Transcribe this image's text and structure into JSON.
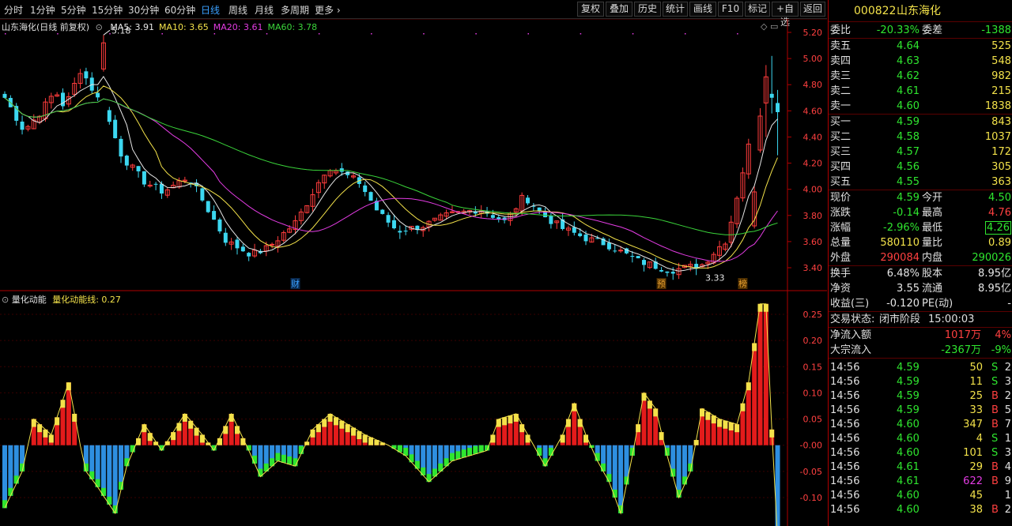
{
  "toolbar": {
    "periods": [
      "分时",
      "1分钟",
      "5分钟",
      "15分钟",
      "30分钟",
      "60分钟",
      "日线",
      "周线",
      "月线",
      "多周期",
      "更多"
    ],
    "active_period": "日线",
    "buttons": [
      "复权",
      "叠加",
      "历史",
      "统计",
      "画线",
      "F10",
      "标记",
      "+自选",
      "返回"
    ]
  },
  "main_chart": {
    "title": "山东海化(日线 前复权)",
    "ma_legend": [
      {
        "label": "MA5: 3.91",
        "color": "#e6e6e6"
      },
      {
        "label": "MA10: 3.65",
        "color": "#f3e24a"
      },
      {
        "label": "MA20: 3.61",
        "color": "#e33ce3"
      },
      {
        "label": "MA60: 3.78",
        "color": "#3ad43a"
      }
    ],
    "y_ticks": [
      "5.20",
      "5.00",
      "4.80",
      "4.60",
      "4.40",
      "4.20",
      "4.00",
      "3.80",
      "3.60",
      "3.40"
    ],
    "high_label": "5.18",
    "low_label": "3.33",
    "markers": [
      {
        "text": "财",
        "color": "#3aa0ff"
      },
      {
        "text": "预",
        "color": "#e8a030"
      },
      {
        "text": "榜",
        "color": "#e8a030"
      }
    ],
    "colors": {
      "up": "#ff3c3c",
      "down": "#3cd7f0"
    }
  },
  "indicator": {
    "title": "量化动能",
    "line_label": "量化动能线: 0.27",
    "y_ticks": [
      "0.25",
      "0.20",
      "0.15",
      "0.10",
      "0.05",
      "-0.00",
      "-0.05",
      "-0.10"
    ]
  },
  "quote": {
    "code": "000822",
    "name": "山东海化",
    "webi": {
      "label": "委比",
      "value": "-20.33%",
      "label2": "委差",
      "value2": "-1388"
    },
    "asks": [
      {
        "label": "卖五",
        "price": "4.64",
        "vol": "525"
      },
      {
        "label": "卖四",
        "price": "4.63",
        "vol": "548"
      },
      {
        "label": "卖三",
        "price": "4.62",
        "vol": "982"
      },
      {
        "label": "卖二",
        "price": "4.61",
        "vol": "215"
      },
      {
        "label": "卖一",
        "price": "4.60",
        "vol": "1838"
      }
    ],
    "bids": [
      {
        "label": "买一",
        "price": "4.59",
        "vol": "843"
      },
      {
        "label": "买二",
        "price": "4.58",
        "vol": "1037"
      },
      {
        "label": "买三",
        "price": "4.57",
        "vol": "172"
      },
      {
        "label": "买四",
        "price": "4.56",
        "vol": "305"
      },
      {
        "label": "买五",
        "price": "4.55",
        "vol": "363"
      }
    ],
    "stats1": [
      {
        "l": "现价",
        "v": "4.59",
        "vc": "green",
        "r": "今开",
        "rv": "4.50",
        "rvc": "green"
      },
      {
        "l": "涨跌",
        "v": "-0.14",
        "vc": "green",
        "r": "最高",
        "rv": "4.76",
        "rvc": "red"
      },
      {
        "l": "涨幅",
        "v": "-2.96%",
        "vc": "green",
        "r": "最低",
        "rv": "4.26",
        "rvc": "green",
        "boxed": true
      },
      {
        "l": "总量",
        "v": "580110",
        "vc": "yellow",
        "r": "量比",
        "rv": "0.89",
        "rvc": "yellow"
      },
      {
        "l": "外盘",
        "v": "290084",
        "vc": "red",
        "r": "内盘",
        "rv": "290026",
        "rvc": "green"
      }
    ],
    "stats2": [
      {
        "l": "换手",
        "v": "6.48%",
        "r": "股本",
        "rv": "8.95亿"
      },
      {
        "l": "净资",
        "v": "3.55",
        "r": "流通",
        "rv": "8.95亿"
      },
      {
        "l": "收益(三)",
        "v": "-0.120",
        "r": "PE(动)",
        "rv": "-"
      }
    ],
    "status": {
      "label": "交易状态:",
      "value": "闭市阶段",
      "time": "15:00:03"
    },
    "flows": [
      {
        "label": "净流入额",
        "value": "1017万",
        "vc": "red",
        "pct": "4%",
        "pc": "red"
      },
      {
        "label": "大宗流入",
        "value": "-2367万",
        "vc": "green",
        "pct": "-9%",
        "pc": "green"
      }
    ],
    "ticks": [
      {
        "time": "14:56",
        "price": "4.59",
        "vol": "50",
        "vc": "yellow",
        "side": "S",
        "sc": "green",
        "cnt": "2"
      },
      {
        "time": "14:56",
        "price": "4.59",
        "vol": "11",
        "vc": "yellow",
        "side": "S",
        "sc": "green",
        "cnt": "3"
      },
      {
        "time": "14:56",
        "price": "4.59",
        "vol": "25",
        "vc": "yellow",
        "side": "B",
        "sc": "red",
        "cnt": "2"
      },
      {
        "time": "14:56",
        "price": "4.59",
        "vol": "33",
        "vc": "yellow",
        "side": "B",
        "sc": "red",
        "cnt": "5"
      },
      {
        "time": "14:56",
        "price": "4.60",
        "vol": "347",
        "vc": "yellow",
        "side": "B",
        "sc": "red",
        "cnt": "7"
      },
      {
        "time": "14:56",
        "price": "4.60",
        "vol": "4",
        "vc": "yellow",
        "side": "S",
        "sc": "green",
        "cnt": "1"
      },
      {
        "time": "14:56",
        "price": "4.60",
        "vol": "101",
        "vc": "yellow",
        "side": "S",
        "sc": "green",
        "cnt": "3"
      },
      {
        "time": "14:56",
        "price": "4.61",
        "vol": "29",
        "vc": "yellow",
        "side": "B",
        "sc": "red",
        "cnt": "4"
      },
      {
        "time": "14:56",
        "price": "4.61",
        "vol": "622",
        "vc": "magenta",
        "side": "B",
        "sc": "red",
        "cnt": "9"
      },
      {
        "time": "14:56",
        "price": "4.60",
        "vol": "45",
        "vc": "yellow",
        "side": "",
        "sc": "red",
        "cnt": "1"
      },
      {
        "time": "14:56",
        "price": "4.60",
        "vol": "38",
        "vc": "yellow",
        "side": "B",
        "sc": "red",
        "cnt": "2"
      }
    ]
  }
}
